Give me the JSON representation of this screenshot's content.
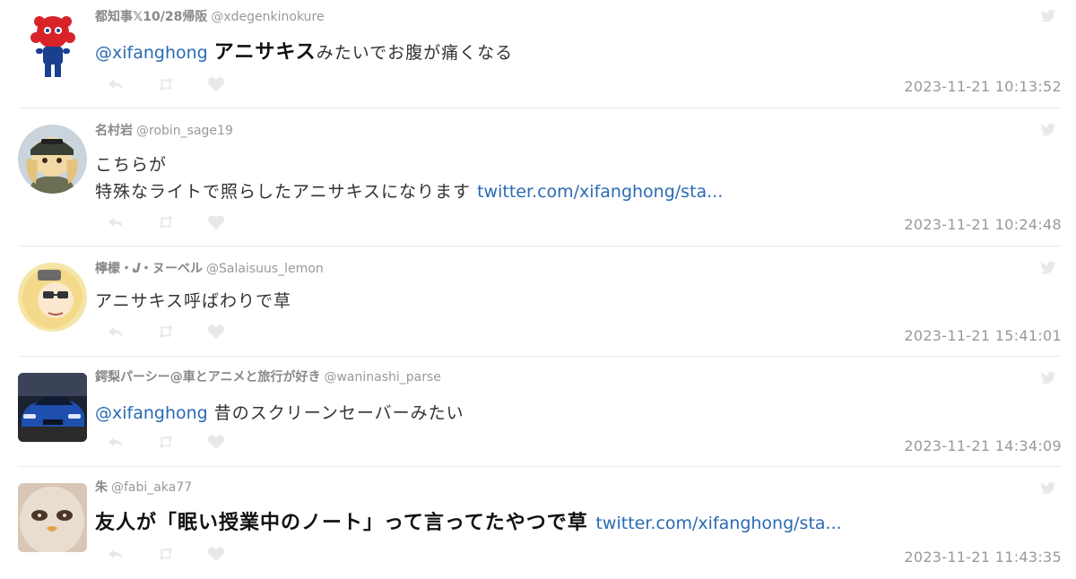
{
  "colors": {
    "link": "#2a6ab3",
    "meta": "#999999",
    "name": "#888888",
    "icon": "#e8e8e8",
    "divider": "#e9e9e9"
  },
  "tweets": [
    {
      "name": "都知事𝕏10/28帰阪",
      "handle": "@xdegenkinokure",
      "mention": "@xifanghong",
      "strong": "アニサキス",
      "text": "みたいでお腹が痛くなる",
      "timestamp": "2023-11-21 10:13:52",
      "icons": [
        "reply-icon",
        "retweet-icon",
        "like-icon",
        "twitter-bird-icon"
      ]
    },
    {
      "name": "名村岩",
      "handle": "@robin_sage19",
      "line1": "こちらが",
      "line2": "特殊なライトで照らしたアニサキスになります",
      "link": "twitter.com/xifanghong/sta...",
      "timestamp": "2023-11-21 10:24:48"
    },
    {
      "name": "檸檬・𝑱・ヌーベル",
      "handle": "@Salaisuus_lemon",
      "text": "アニサキス呼ばわりで草",
      "timestamp": "2023-11-21 15:41:01"
    },
    {
      "name": "鍔梨パーシー@車とアニメと旅行が好き",
      "handle": "@waninashi_parse",
      "mention": "@xifanghong",
      "text": "昔のスクリーンセーバーみたい",
      "timestamp": "2023-11-21 14:34:09"
    },
    {
      "name": "朱",
      "handle": "@fabi_aka77",
      "text": "友人が「眠い授業中のノート」って言ってたやつで草",
      "link": "twitter.com/xifanghong/sta...",
      "timestamp": "2023-11-21 11:43:35"
    }
  ]
}
